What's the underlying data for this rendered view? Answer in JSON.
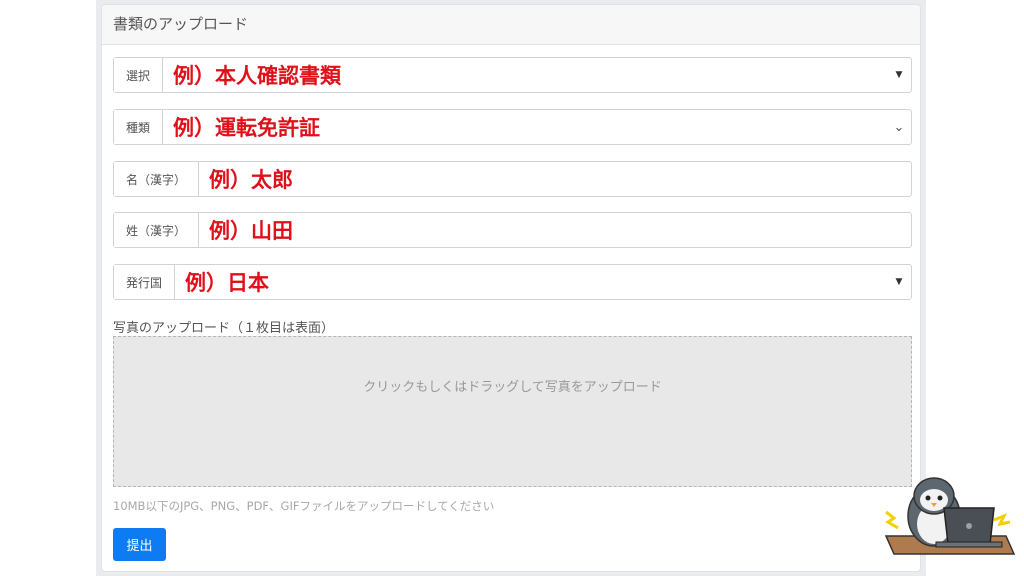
{
  "card": {
    "title": "書類のアップロード"
  },
  "fields": {
    "select": {
      "label": "選択",
      "value": "例）本人確認書類"
    },
    "type": {
      "label": "種類",
      "value": "例）運転免許証"
    },
    "first_name": {
      "label": "名（漢字）",
      "value": "例）太郎"
    },
    "last_name": {
      "label": "姓（漢字）",
      "value": "例）山田"
    },
    "country": {
      "label": "発行国",
      "value": "例）日本"
    }
  },
  "photo": {
    "label": "写真のアップロード（１枚目は表面）",
    "dropzone_text": "クリックもしくはドラッグして写真をアップロード",
    "help": "10MB以下のJPG、PNG、PDF、GIFファイルをアップロードしてください"
  },
  "submit_label": "提出",
  "colors": {
    "example_text": "#e0101a",
    "submit": "#0d7cf2",
    "dropzone": "#e8e8e8"
  },
  "icons": [
    "caret-down-icon",
    "chevron-down-icon",
    "penguin-mascot"
  ]
}
